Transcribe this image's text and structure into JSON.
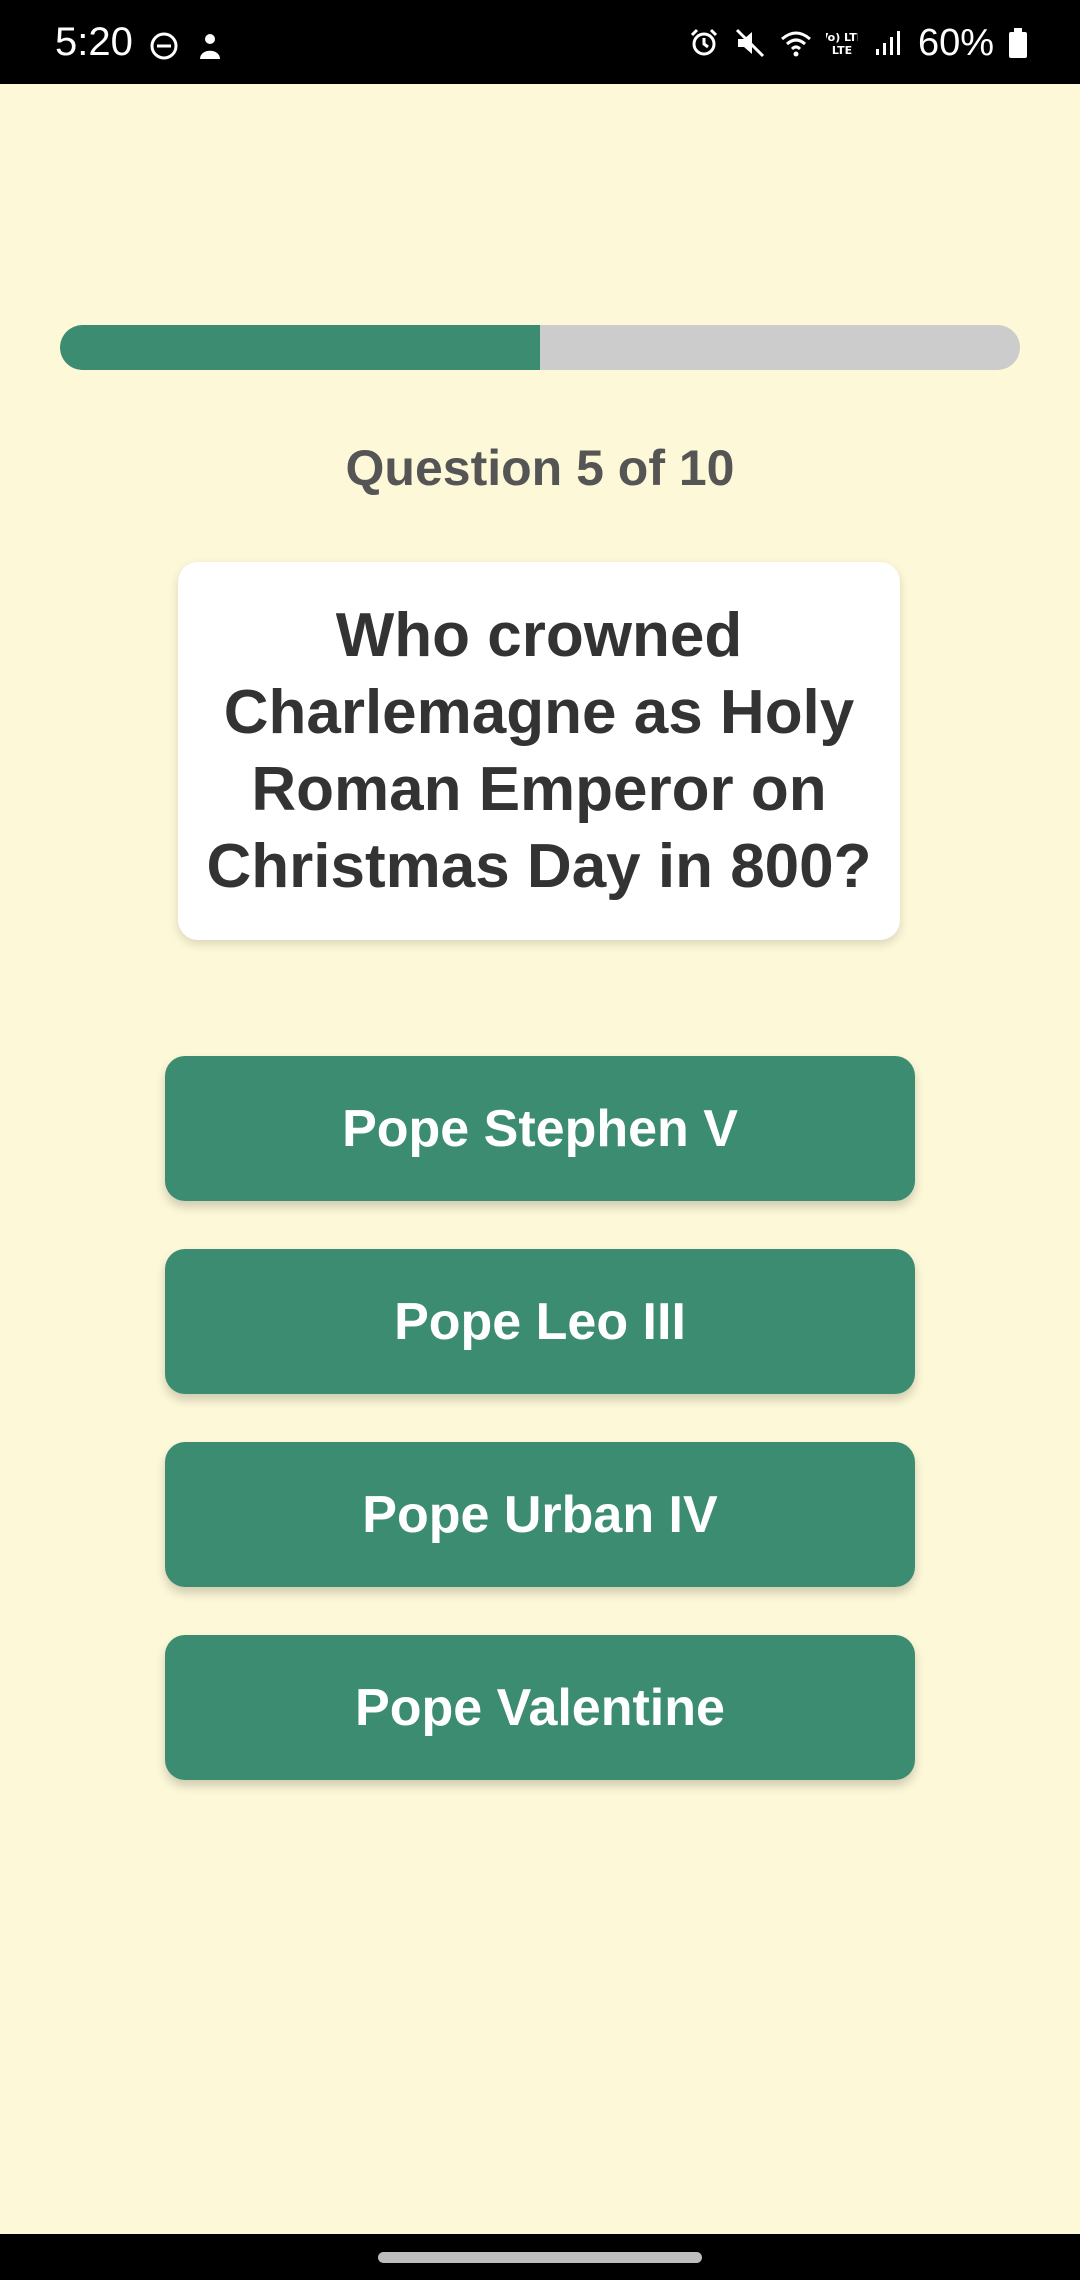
{
  "status_bar": {
    "time": "5:20",
    "battery_percent": "60%",
    "network_label": "Vo) LTE",
    "left_icons": [
      "do-not-disturb-icon",
      "notification-app-icon"
    ],
    "right_icons": [
      "alarm-icon",
      "mute-icon",
      "wifi-icon",
      "lte-icon",
      "signal-icon",
      "battery-icon"
    ]
  },
  "quiz": {
    "progress": 0.5,
    "counter": "Question 5 of 10",
    "question": "Who crowned Charlemagne as Holy Roman Emperor on Christmas Day in 800?",
    "answers": [
      {
        "label": "Pope Stephen V"
      },
      {
        "label": "Pope Leo III"
      },
      {
        "label": "Pope Urban IV"
      },
      {
        "label": "Pope Valentine"
      }
    ]
  },
  "colors": {
    "background": "#fdf8d8",
    "accent": "#3b8c71",
    "track": "#cccccc",
    "card": "#ffffff",
    "counter_text": "#555555",
    "question_text": "#333333"
  }
}
